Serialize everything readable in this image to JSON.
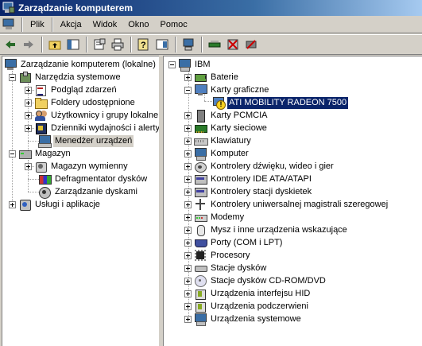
{
  "window": {
    "title": "Zarządzanie komputerem"
  },
  "menu": [
    "Plik",
    "Akcja",
    "Widok",
    "Okno",
    "Pomoc"
  ],
  "toolbar": {
    "buttons": [
      "back-arrow-icon",
      "forward-arrow-icon",
      "up-folder-icon",
      "show-tree-icon",
      "properties-icon",
      "print-icon",
      "help-icon",
      "export-list-icon",
      "scan-hardware-icon",
      "update-driver-icon",
      "uninstall-icon",
      "disable-icon"
    ]
  },
  "left_tree": {
    "root": "Zarządzanie komputerem (lokalne)",
    "system_tools": {
      "label": "Narzędzia systemowe",
      "items": [
        "Podgląd zdarzeń",
        "Foldery udostępnione",
        "Użytkownicy i grupy lokalne",
        "Dzienniki wydajności i alerty",
        "Menedżer urządzeń"
      ]
    },
    "storage": {
      "label": "Magazyn",
      "items": [
        "Magazyn wymienny",
        "Defragmentator dysków",
        "Zarządzanie dyskami"
      ]
    },
    "services": "Usługi i aplikacje"
  },
  "right_tree": {
    "root": "IBM",
    "categories": [
      "Baterie",
      "Karty graficzne",
      "Karty PCMCIA",
      "Karty sieciowe",
      "Klawiatury",
      "Komputer",
      "Kontrolery dźwięku, wideo i gier",
      "Kontrolery IDE ATA/ATAPI",
      "Kontrolery stacji dyskietek",
      "Kontrolery uniwersalnej magistrali szeregowej",
      "Modemy",
      "Mysz i inne urządzenia wskazujące",
      "Porty (COM i LPT)",
      "Procesory",
      "Stacje dysków",
      "Stacje dysków CD-ROM/DVD",
      "Urządzenia interfejsu HID",
      "Urządzenia podczerwieni",
      "Urządzenia systemowe"
    ],
    "display_adapter_device": "ATI MOBILITY RADEON 7500"
  }
}
